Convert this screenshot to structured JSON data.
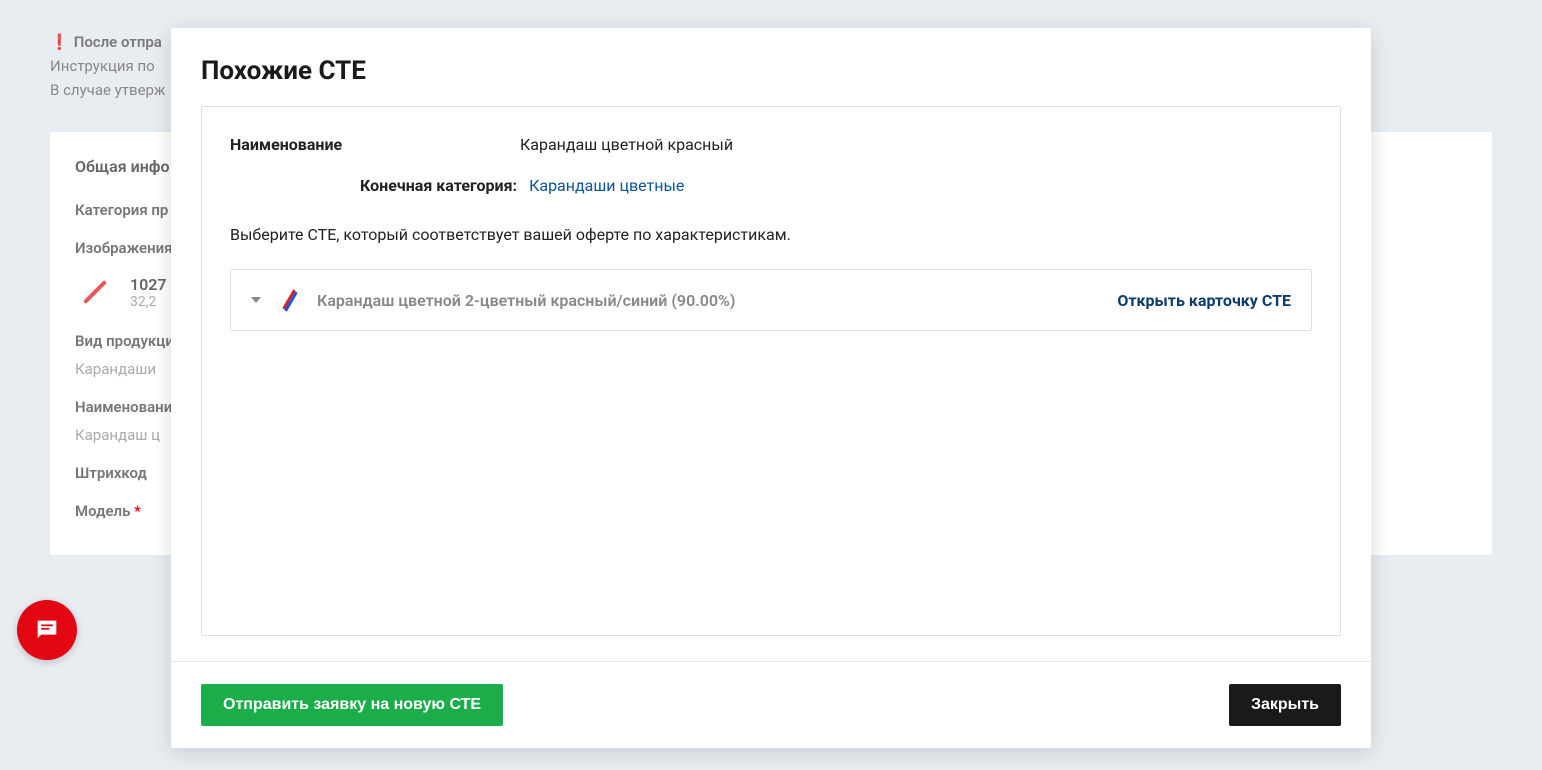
{
  "background": {
    "notice_line1": "После отпра",
    "notice_line2": "Инструкция по",
    "notice_line3": "В случае утверж",
    "tab_label": "Общая инфо",
    "category_label": "Категория пр",
    "images_label": "Изображения",
    "image_name": "1027",
    "image_size": "32,2",
    "product_type_label": "Вид продукци",
    "product_type_value": "Карандаши",
    "name_label": "Наименовани",
    "name_value": "Карандаш ц",
    "barcode_label": "Штрихкод",
    "model_label": "Модель"
  },
  "modal": {
    "title": "Похожие СТЕ",
    "name_label": "Наименование",
    "name_value": "Карандаш цветной красный",
    "category_label": "Конечная категория:",
    "category_value": "Карандаши цветные",
    "instruction": "Выберите СТЕ, который соответствует вашей оферте по характеристикам.",
    "cte_items": [
      {
        "name": "Карандаш цветной 2-цветный красный/синий (90.00%)",
        "link_label": "Открыть карточку СТЕ"
      }
    ],
    "submit_button": "Отправить заявку на новую СТЕ",
    "close_button": "Закрыть"
  }
}
